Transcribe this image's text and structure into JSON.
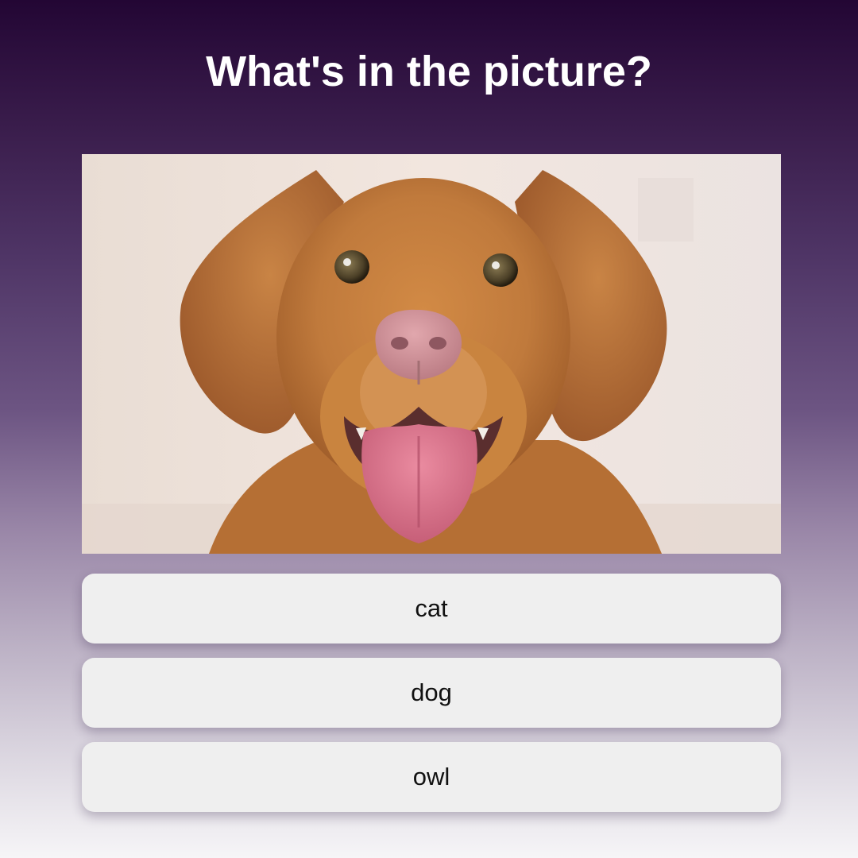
{
  "quiz": {
    "question": "What's in the picture?",
    "image": {
      "subject": "dog",
      "description_icon": "dog-photo"
    },
    "options": [
      {
        "label": "cat"
      },
      {
        "label": "dog"
      },
      {
        "label": "owl"
      }
    ]
  },
  "colors": {
    "background_top": "#230634",
    "background_bottom": "#f6f5f7",
    "title": "#ffffff",
    "option_bg": "#efefef",
    "option_text": "#111111",
    "dog_fur": "#c07a3c",
    "dog_nose": "#c98a92",
    "dog_tongue": "#d46d86"
  }
}
